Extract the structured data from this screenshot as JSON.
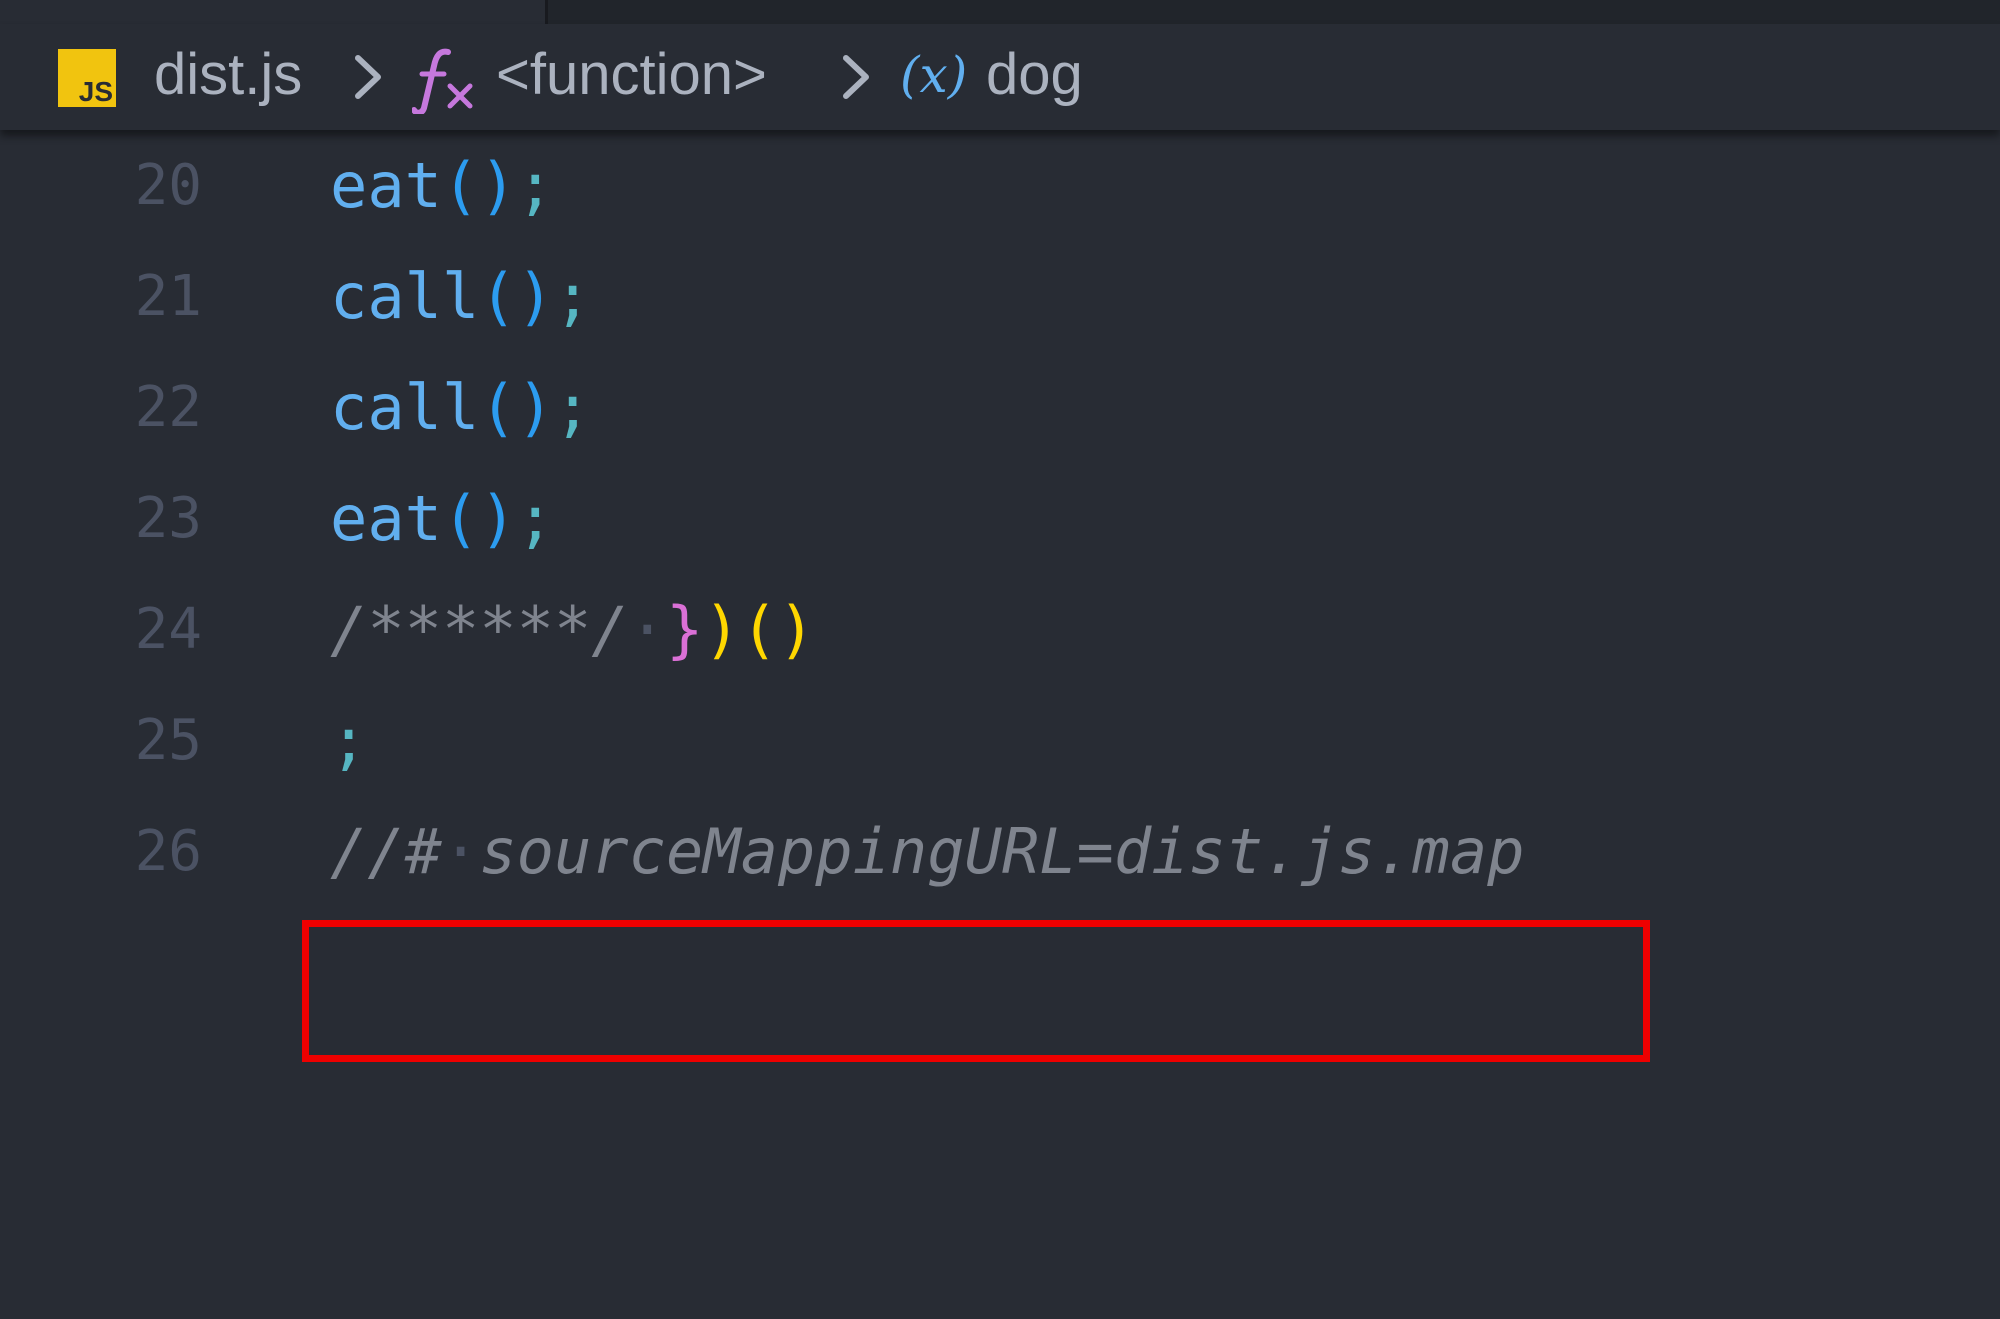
{
  "breadcrumb": {
    "file_icon_label": "JS",
    "file": "dist.js",
    "function_label": "<function>",
    "variable_icon": "(x)",
    "variable": "dog"
  },
  "code_lines": [
    {
      "number": "20",
      "fn": "eat",
      "parens": "()",
      "semi": ";"
    },
    {
      "number": "21",
      "fn": "call",
      "parens": "()",
      "semi": ";"
    },
    {
      "number": "22",
      "fn": "call",
      "parens": "()",
      "semi": ";"
    },
    {
      "number": "23",
      "fn": "eat",
      "parens": "()",
      "semi": ";"
    },
    {
      "number": "24",
      "comment": "/******/",
      "whitespace_dot": "·",
      "brace": "}",
      "close_paren": ")",
      "call_parens": "()"
    },
    {
      "number": "25",
      "semi": ";"
    },
    {
      "number": "26",
      "comment_a": "//#",
      "whitespace_dot": "·",
      "comment_b": "sourceMappingURL=dist.js.map"
    }
  ],
  "colors": {
    "background": "#282c34",
    "function_name": "#61afef",
    "comment": "#7f848e",
    "highlight_border": "#ee0000",
    "js_icon": "#f1c40f"
  },
  "icons": [
    "js-file-icon",
    "chevron-right-icon",
    "function-icon",
    "variable-icon"
  ]
}
